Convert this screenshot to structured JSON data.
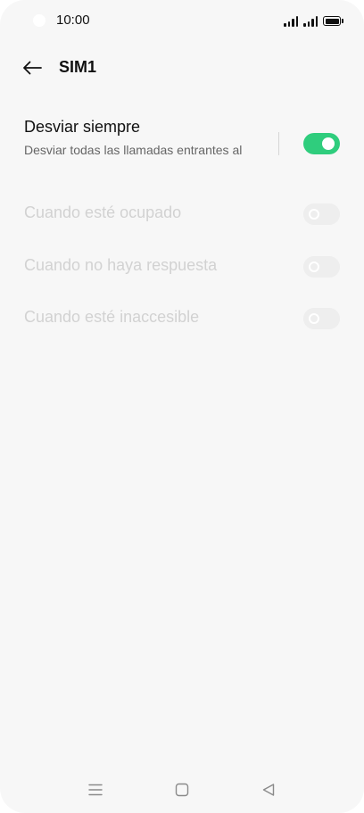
{
  "status_bar": {
    "time": "10:00"
  },
  "header": {
    "title": "SIM1",
    "back_icon": "arrow-left-icon"
  },
  "forward_always": {
    "title": "Desviar siempre",
    "subtitle": "Desviar todas las llamadas entrantes al",
    "enabled": true
  },
  "options": [
    {
      "title": "Cuando esté ocupado",
      "enabled": false,
      "disabled": true
    },
    {
      "title": "Cuando no haya respuesta",
      "enabled": false,
      "disabled": true
    },
    {
      "title": "Cuando esté inaccesible",
      "enabled": false,
      "disabled": true
    }
  ],
  "colors": {
    "toggle_on": "#2fcd7d",
    "toggle_off": "#eeeeee",
    "disabled_text": "#d2d2d2"
  },
  "nav_bar": {
    "menu_icon": "menu-icon",
    "home_icon": "home-square-icon",
    "back_icon": "back-triangle-icon"
  }
}
